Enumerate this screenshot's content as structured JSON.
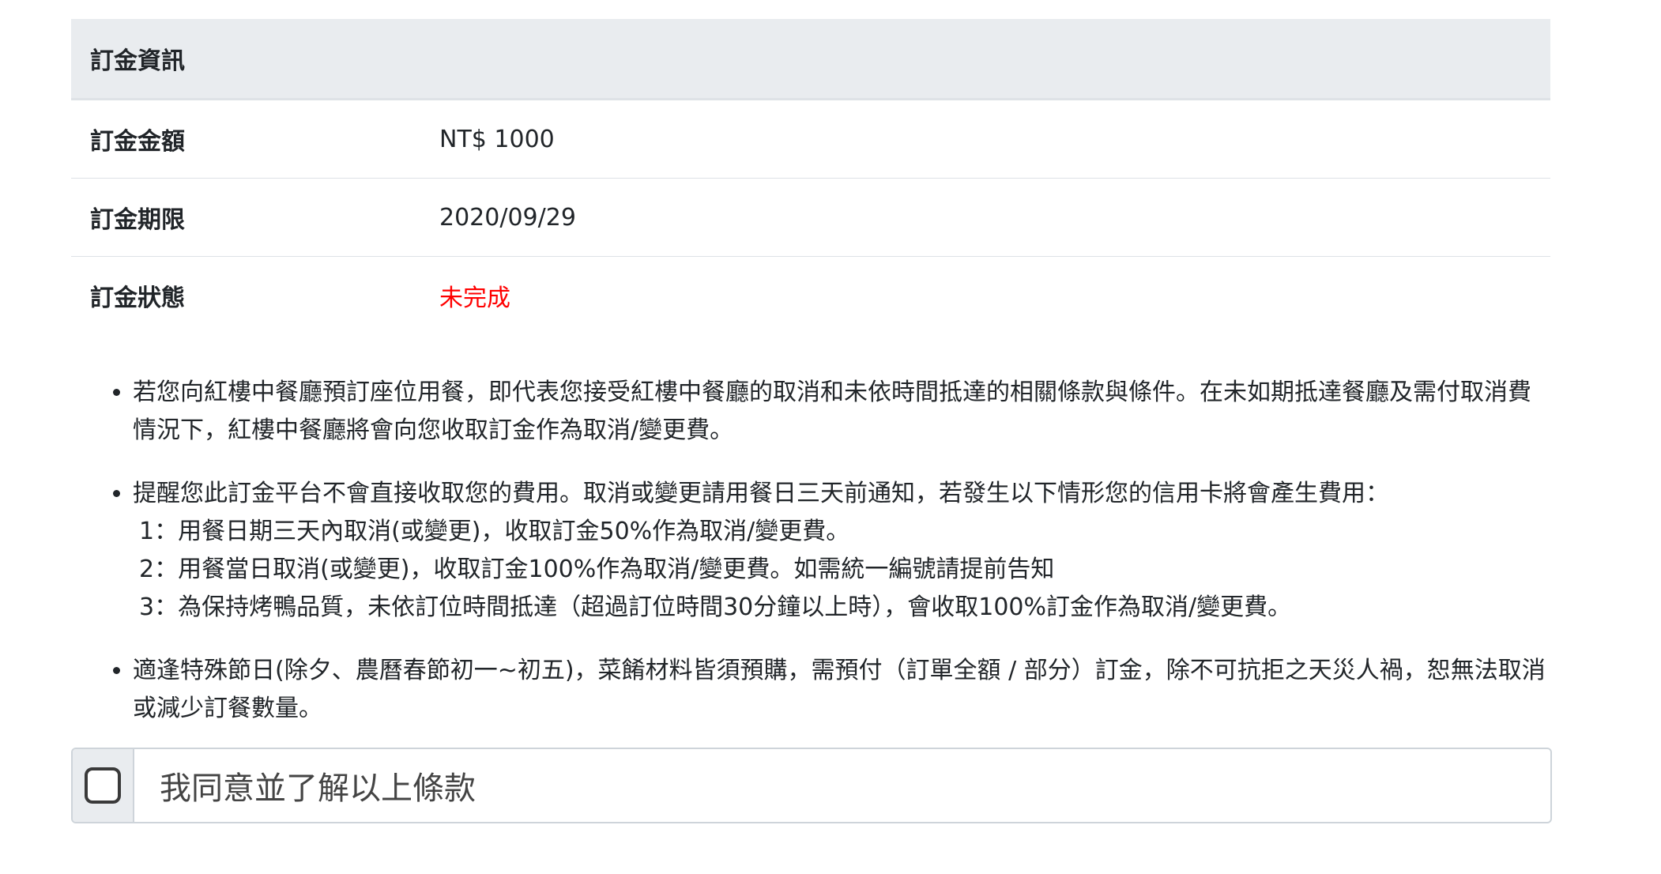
{
  "deposit": {
    "header": "訂金資訊",
    "rows": [
      {
        "label": "訂金金額",
        "value": "NT$ 1000"
      },
      {
        "label": "訂金期限",
        "value": "2020/09/29"
      },
      {
        "label": "訂金狀態",
        "value": "未完成"
      }
    ],
    "status_color": "#ff0000"
  },
  "notes": [
    {
      "text": "若您向紅樓中餐廳預訂座位用餐，即代表您接受紅樓中餐廳的取消和未依時間抵達的相關條款與條件。在未如期抵達餐廳及需付取消費情況下，紅樓中餐廳將會向您收取訂金作為取消/變更費。"
    },
    {
      "text": "提醒您此訂金平台不會直接收取您的費用。取消或變更請用餐日三天前通知，若發生以下情形您的信用卡將會產生費用：",
      "items": [
        "1：用餐日期三天內取消(或變更)，收取訂金50%作為取消/變更費。",
        "2：用餐當日取消(或變更)，收取訂金100%作為取消/變更費。如需統一編號請提前告知",
        "3：為保持烤鴨品質，未依訂位時間抵達（超過訂位時間30分鐘以上時），會收取100%訂金作為取消/變更費。"
      ]
    },
    {
      "text": "適逢特殊節日(除夕、農曆春節初一~初五)，菜餚材料皆須預購，需預付（訂單全額 / 部分）訂金，除不可抗拒之天災人禍，恕無法取消或減少訂餐數量。"
    }
  ],
  "agree": {
    "label": "我同意並了解以上條款",
    "checked": false
  }
}
